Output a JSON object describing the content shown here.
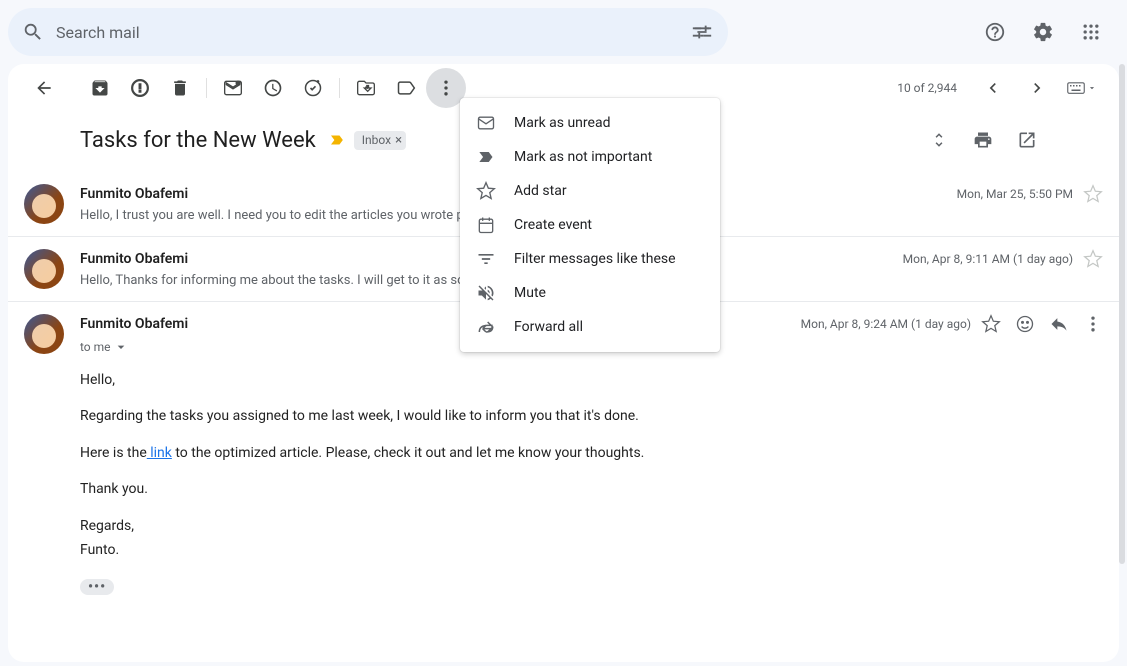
{
  "search": {
    "placeholder": "Search mail"
  },
  "toolbar": {
    "count_text": "10 of 2,944"
  },
  "subject": {
    "text": "Tasks for the New Week",
    "label": "Inbox"
  },
  "messages": [
    {
      "sender": "Funmito Obafemi",
      "time": "Mon, Mar 25, 5:50 PM",
      "snippet": "Hello, I trust you are well. I need you to edit the articles you wrote                                                                     posts, please check them. In addition, I need"
    },
    {
      "sender": "Funmito Obafemi",
      "time": "Mon, Apr 8, 9:11 AM (1 day ago)",
      "snippet": "Hello, Thanks for informing me about the tasks. I will get to it as so                                                               e. Regards, Funto."
    },
    {
      "sender": "Funmito Obafemi",
      "time": "Mon, Apr 8, 9:24 AM (1 day ago)",
      "recipient": "to me",
      "body": {
        "greeting": "Hello,",
        "p1": "Regarding the tasks you assigned to me last week, I would like to inform you that it's done.",
        "p2_pre": "Here is the",
        "p2_link": " link",
        "p2_post": " to the optimized article. Please, check it out and let me know your thoughts.",
        "thanks": "Thank you.",
        "regards": "Regards,",
        "signature": "Funto."
      }
    }
  ],
  "menu": {
    "items": [
      "Mark as unread",
      "Mark as not important",
      "Add star",
      "Create event",
      "Filter messages like these",
      "Mute",
      "Forward all"
    ]
  }
}
